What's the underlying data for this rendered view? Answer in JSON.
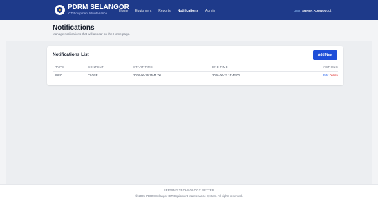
{
  "header": {
    "brand_title": "PDRM SELANGOR",
    "brand_subtitle": "ICT Equipment Maintenance",
    "nav": [
      {
        "label": "Home"
      },
      {
        "label": "Equipment"
      },
      {
        "label": "Reports"
      },
      {
        "label": "Notifications",
        "active": true
      },
      {
        "label": "Admin"
      }
    ],
    "user_prefix": "User:",
    "user_name": "SUPER ADMIN",
    "logout_label": "Logout",
    "bar_color": "#1e3a8a"
  },
  "page": {
    "title": "Notifications",
    "subtitle": "Manage notifications that will appear on the Home page."
  },
  "notifications": {
    "list_title": "Notifications List",
    "add_label": "Add New",
    "columns": [
      "TYPE",
      "CONTENT",
      "START TIME",
      "END TIME",
      "ACTIONS"
    ],
    "rows": [
      {
        "type": "INFO",
        "content": "CLOSE",
        "start_time": "2026-06-26 15:41:00",
        "end_time": "2026-06-27 15:42:00",
        "edit_label": "Edit",
        "delete_label": "Delete"
      }
    ]
  },
  "footer": {
    "tagline": "SERVING TECHNOLOGY BETTER",
    "copyright": "© 2025 PDRM Selangor ICT Equipment Maintenance System. All rights reserved."
  }
}
